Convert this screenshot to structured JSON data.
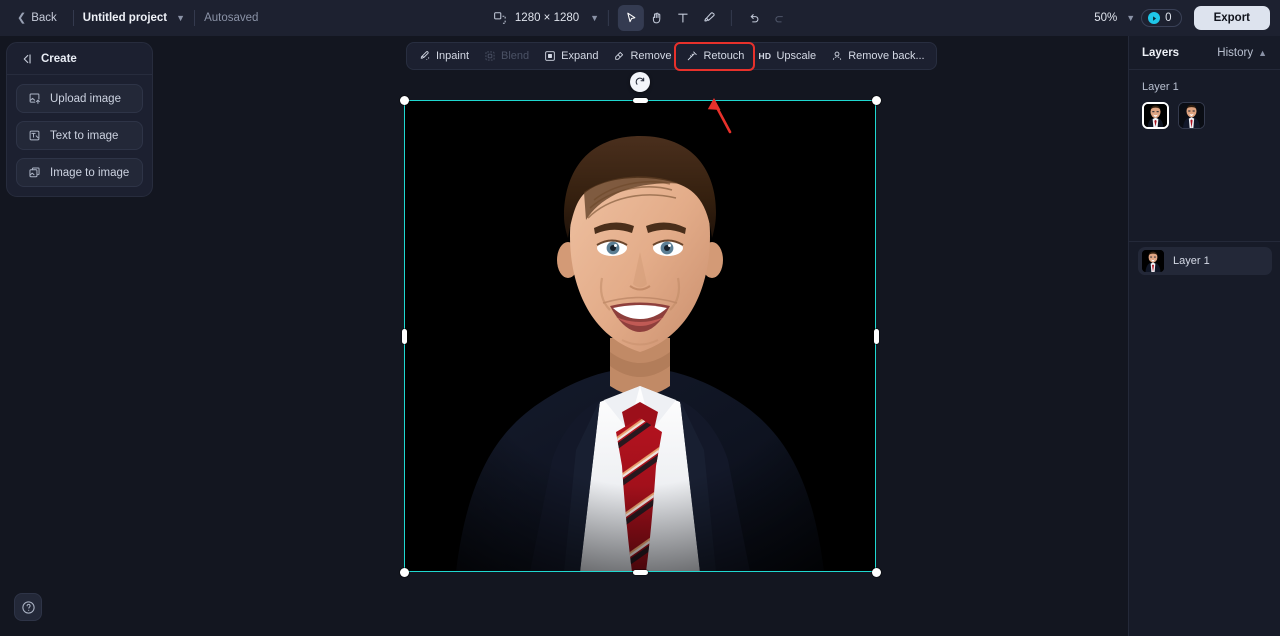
{
  "header": {
    "back_label": "Back",
    "project_name": "Untitled project",
    "autosave_label": "Autosaved",
    "canvas_size_label": "1280 × 1280",
    "zoom_label": "50%",
    "credits_count": "0",
    "export_label": "Export",
    "tools": [
      {
        "name": "resize-canvas-icon",
        "label": "Resize canvas",
        "active": false
      },
      {
        "name": "select-tool-icon",
        "label": "Select",
        "active": true
      },
      {
        "name": "hand-tool-icon",
        "label": "Hand",
        "active": false
      },
      {
        "name": "text-tool-icon",
        "label": "Text",
        "active": false
      },
      {
        "name": "brush-tool-icon",
        "label": "Brush",
        "active": false
      },
      {
        "name": "undo-icon",
        "label": "Undo",
        "active": false
      },
      {
        "name": "redo-icon",
        "label": "Redo",
        "active": false
      }
    ]
  },
  "sidebar": {
    "title": "Create",
    "collapse_icon": "collapse-panel-icon",
    "items": [
      {
        "label": "Upload image",
        "icon": "upload-image-icon"
      },
      {
        "label": "Text to image",
        "icon": "text-to-image-icon"
      },
      {
        "label": "Image to image",
        "icon": "image-to-image-icon"
      }
    ],
    "help_icon": "help-circle-icon"
  },
  "edit_toolbar": {
    "items": [
      {
        "label": "Inpaint",
        "icon": "inpaint-icon",
        "disabled": false,
        "highlighted": false
      },
      {
        "label": "Blend",
        "icon": "blend-icon",
        "disabled": true,
        "highlighted": false
      },
      {
        "label": "Expand",
        "icon": "expand-icon",
        "disabled": false,
        "highlighted": false
      },
      {
        "label": "Remove",
        "icon": "remove-icon",
        "disabled": false,
        "highlighted": false
      },
      {
        "label": "Retouch",
        "icon": "retouch-icon",
        "disabled": false,
        "highlighted": true
      },
      {
        "label": "Upscale",
        "icon": "hd-icon",
        "disabled": false,
        "highlighted": false
      },
      {
        "label": "Remove back...",
        "icon": "remove-background-icon",
        "disabled": false,
        "highlighted": false
      }
    ]
  },
  "canvas": {
    "rotate_icon": "rotate-handle-icon",
    "selection_color": "#1fd8d0",
    "image_alt": "Portrait of smiling man in navy suit, white shirt and red striped tie on black background",
    "annotation_color": "#e8312b"
  },
  "layers_panel": {
    "title": "Layers",
    "history_label": "History",
    "history_chevron": "chevron-up-icon",
    "group_label": "Layer 1",
    "variant_thumbnails": [
      {
        "name": "variant-thumbnail-1",
        "selected": true
      },
      {
        "name": "variant-thumbnail-2",
        "selected": false
      }
    ],
    "layer_items": [
      {
        "label": "Layer 1"
      }
    ]
  },
  "colors": {
    "header_bg": "#1d2130",
    "canvas_bg": "#131620",
    "panel_bg": "#1c2030",
    "accent_teal": "#1fd8d0",
    "accent_red": "#e8312b",
    "coin_cyan": "#1fc7e8",
    "export_bg": "#dde3ee"
  }
}
